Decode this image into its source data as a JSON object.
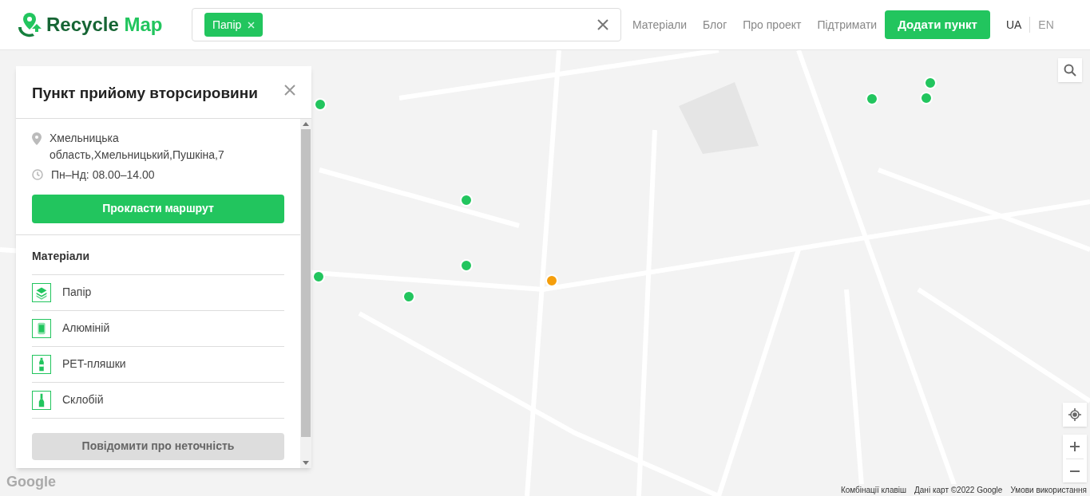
{
  "header": {
    "logo": {
      "word_1": "Recycle",
      "word_2": "Map"
    },
    "search": {
      "chips": [
        {
          "label": "Папір"
        }
      ]
    },
    "nav": [
      {
        "label": "Матеріали"
      },
      {
        "label": "Блог"
      },
      {
        "label": "Про проект"
      },
      {
        "label": "Підтримати"
      }
    ],
    "add_button": "Додати пункт",
    "languages": [
      {
        "label": "UA",
        "selected": true
      },
      {
        "label": "EN",
        "selected": false
      }
    ]
  },
  "panel": {
    "title": "Пункт прийому вторсировини",
    "address": "Хмельницька область,Хмельницький,Пушкіна,7",
    "hours": "Пн–Нд: 08.00–14.00",
    "route_button": "Прокласти маршрут",
    "materials_heading": "Матеріали",
    "materials": [
      {
        "kind": "paper",
        "label": "Папір"
      },
      {
        "kind": "can",
        "label": "Алюміній"
      },
      {
        "kind": "pet",
        "label": "PET-пляшки"
      },
      {
        "kind": "glass",
        "label": "Склобій"
      }
    ],
    "report_button": "Повідомити про неточність"
  },
  "map": {
    "markers": [
      {
        "selected": false
      },
      {
        "selected": false
      },
      {
        "selected": false
      },
      {
        "selected": false
      },
      {
        "selected": false
      },
      {
        "selected": true
      },
      {
        "selected": false
      },
      {
        "selected": false
      },
      {
        "selected": false
      }
    ],
    "logo": "Google",
    "footer": [
      {
        "label": "Комбінації клавіш"
      },
      {
        "label": "Дані карт ©2022 Google"
      },
      {
        "label": "Умови використання"
      }
    ]
  }
}
